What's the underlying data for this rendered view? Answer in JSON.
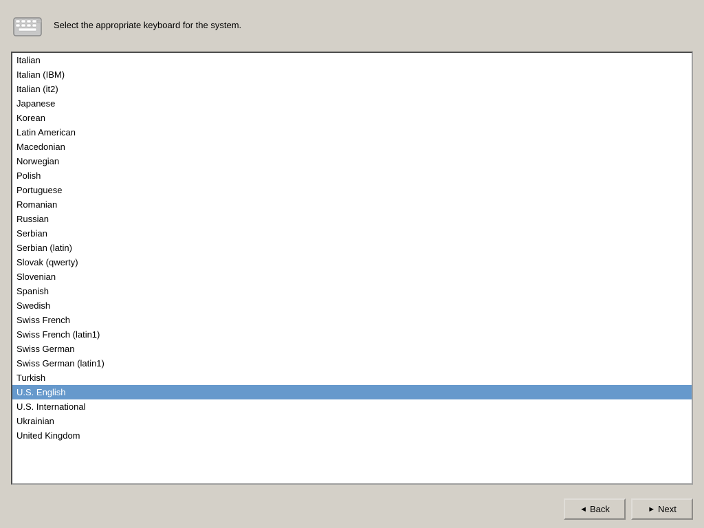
{
  "header": {
    "icon_label": "keyboard-icon",
    "description": "Select the appropriate keyboard for\nthe system."
  },
  "list": {
    "items": [
      "Italian",
      "Italian (IBM)",
      "Italian (it2)",
      "Japanese",
      "Korean",
      "Latin American",
      "Macedonian",
      "Norwegian",
      "Polish",
      "Portuguese",
      "Romanian",
      "Russian",
      "Serbian",
      "Serbian (latin)",
      "Slovak (qwerty)",
      "Slovenian",
      "Spanish",
      "Swedish",
      "Swiss French",
      "Swiss French (latin1)",
      "Swiss German",
      "Swiss German (latin1)",
      "Turkish",
      "U.S. English",
      "U.S. International",
      "Ukrainian",
      "United Kingdom"
    ],
    "selected": "U.S. English"
  },
  "buttons": {
    "back_label": "Back",
    "next_label": "Next"
  }
}
